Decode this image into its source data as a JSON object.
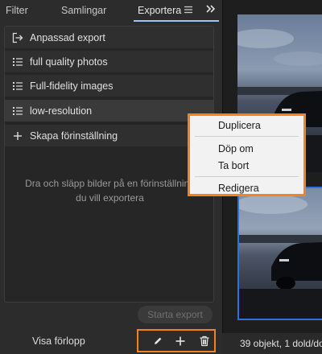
{
  "tabs": {
    "filter": "Filter",
    "collections": "Samlingar",
    "export": "Exportera"
  },
  "icons": {
    "tab_menu": "hamburger-icon",
    "collapse": "double-chevron-right-icon",
    "custom_export": "export-arrow-icon",
    "preset": "list-icon",
    "create": "plus-icon",
    "edit": "pencil-icon",
    "add": "plus-icon",
    "delete": "trash-icon"
  },
  "export_list": {
    "custom_export": "Anpassad export",
    "presets": [
      {
        "label": "full quality photos",
        "selected": false
      },
      {
        "label": "Full-fidelity images",
        "selected": false
      },
      {
        "label": "low-resolution",
        "selected": true
      }
    ],
    "create_preset": "Skapa förinställning",
    "drop_hint": "Dra och släpp bilder på en förinställning du vill exportera"
  },
  "footer": {
    "start_export": "Starta export",
    "show_progress": "Visa förlopp"
  },
  "context_menu": {
    "duplicate": "Duplicera",
    "rename": "Döp om",
    "delete": "Ta bort",
    "edit": "Redigera"
  },
  "status": {
    "text": "39 objekt, 1 dold/dolda"
  },
  "colors": {
    "highlight": "#f58220",
    "selection": "#2e6ee6",
    "tab_underline": "#9ec2ff"
  }
}
